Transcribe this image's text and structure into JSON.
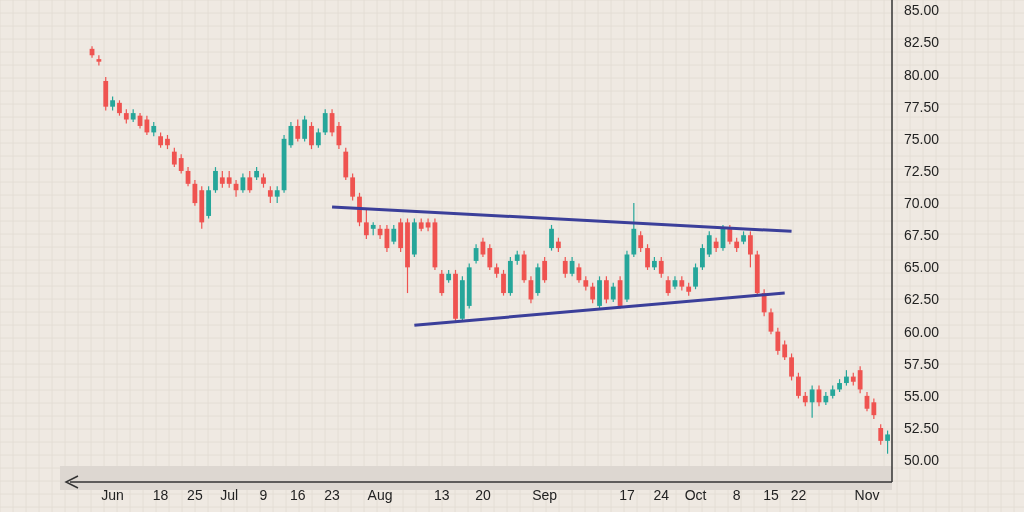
{
  "chart": {
    "chart_data": {
      "type": "candlestick",
      "grid": true,
      "ylim": [
        48.3,
        85.8
      ],
      "categories": [
        null,
        null,
        null,
        "Jun",
        null,
        null,
        null,
        null,
        null,
        null,
        "18",
        null,
        null,
        null,
        null,
        "25",
        null,
        null,
        null,
        null,
        "Jul",
        null,
        null,
        null,
        null,
        "9",
        null,
        null,
        null,
        null,
        "16",
        null,
        null,
        null,
        null,
        "23",
        null,
        null,
        null,
        null,
        null,
        null,
        "Aug",
        null,
        null,
        null,
        null,
        null,
        null,
        null,
        null,
        "13",
        null,
        null,
        null,
        null,
        null,
        "20",
        null,
        null,
        null,
        null,
        null,
        null,
        null,
        null,
        "Sep",
        null,
        null,
        null,
        null,
        null,
        null,
        null,
        null,
        null,
        null,
        null,
        "17",
        null,
        null,
        null,
        null,
        "24",
        null,
        null,
        null,
        null,
        "Oct",
        null,
        null,
        null,
        null,
        null,
        "8",
        null,
        null,
        null,
        null,
        "15",
        null,
        null,
        null,
        "22",
        null,
        null,
        null,
        null,
        null,
        null,
        null,
        null,
        null,
        "Nov",
        null,
        null,
        null
      ],
      "yticks": [
        {
          "value": 50,
          "label": "50.00"
        },
        {
          "value": 52.5,
          "label": "52.50"
        },
        {
          "value": 55,
          "label": "55.00"
        },
        {
          "value": 57.5,
          "label": "57.50"
        },
        {
          "value": 60,
          "label": "60.00"
        },
        {
          "value": 62.5,
          "label": "62.50"
        },
        {
          "value": 65,
          "label": "65.00"
        },
        {
          "value": 67.5,
          "label": "67.50"
        },
        {
          "value": 70,
          "label": "70.00"
        },
        {
          "value": 72.5,
          "label": "72.50"
        },
        {
          "value": 75,
          "label": "75.00"
        },
        {
          "value": 77.5,
          "label": "77.50"
        },
        {
          "value": 80,
          "label": "80.00"
        },
        {
          "value": 82.5,
          "label": "82.50"
        },
        {
          "value": 85,
          "label": "85.00"
        }
      ],
      "ohlc": [
        [
          82,
          82.2,
          81.3,
          81.5
        ],
        [
          81.2,
          81.5,
          80.7,
          81
        ],
        [
          79.5,
          79.8,
          77.2,
          77.5
        ],
        [
          77.5,
          78.3,
          77.2,
          78
        ],
        [
          77.8,
          78,
          76.8,
          77
        ],
        [
          77,
          77.3,
          76.2,
          76.5
        ],
        [
          76.5,
          77.3,
          76.3,
          77
        ],
        [
          76.8,
          77,
          75.8,
          76
        ],
        [
          76.5,
          76.8,
          75.3,
          75.5
        ],
        [
          75.5,
          76.3,
          75.2,
          76
        ],
        [
          75.2,
          75.5,
          74.3,
          74.5
        ],
        [
          75,
          75.3,
          74.2,
          74.5
        ],
        [
          74,
          74.3,
          72.8,
          73
        ],
        [
          73.5,
          73.8,
          72.3,
          72.5
        ],
        [
          72.5,
          72.8,
          71.3,
          71.5
        ],
        [
          71.5,
          71.8,
          69.8,
          70
        ],
        [
          71,
          71.3,
          68,
          68.5
        ],
        [
          69,
          71.3,
          68.8,
          71
        ],
        [
          71,
          72.8,
          70.8,
          72.5
        ],
        [
          72,
          72.5,
          71.2,
          71.5
        ],
        [
          72,
          72.5,
          71.2,
          71.5
        ],
        [
          71.5,
          71.8,
          70.5,
          71
        ],
        [
          71,
          72.3,
          70.8,
          72
        ],
        [
          72,
          72.5,
          70.8,
          71
        ],
        [
          72,
          72.8,
          71.8,
          72.5
        ],
        [
          72,
          72.3,
          71.2,
          71.5
        ],
        [
          71,
          71.3,
          70,
          70.5
        ],
        [
          70.5,
          71.3,
          70,
          71
        ],
        [
          71,
          75.3,
          70.8,
          75
        ],
        [
          74.5,
          76.3,
          74.3,
          76
        ],
        [
          76,
          76.5,
          74.8,
          75
        ],
        [
          75,
          76.8,
          74.8,
          76.5
        ],
        [
          76,
          76.3,
          74.2,
          74.5
        ],
        [
          74.5,
          75.8,
          74.3,
          75.5
        ],
        [
          75.5,
          77.3,
          75.3,
          77
        ],
        [
          77,
          77.3,
          75.2,
          75.5
        ],
        [
          76,
          76.3,
          74.2,
          74.5
        ],
        [
          74,
          74.3,
          71.8,
          72
        ],
        [
          72,
          72.3,
          70.2,
          70.5
        ],
        [
          70.5,
          70.8,
          68.2,
          68.5
        ],
        [
          68.5,
          69.5,
          67.2,
          67.5
        ],
        [
          68,
          68.5,
          67.5,
          68.3
        ],
        [
          68,
          68.3,
          67.2,
          67.5
        ],
        [
          68,
          68.3,
          66.2,
          66.5
        ],
        [
          67,
          68.3,
          66.8,
          68
        ],
        [
          68.5,
          68.8,
          66.2,
          66.5
        ],
        [
          68.5,
          68.8,
          63,
          65
        ],
        [
          66,
          68.8,
          65.8,
          68.5
        ],
        [
          68.5,
          68.8,
          67.8,
          68
        ],
        [
          68.5,
          68.8,
          67.8,
          68.1
        ],
        [
          68.5,
          68.8,
          64.8,
          65
        ],
        [
          64.5,
          64.8,
          62.8,
          63
        ],
        [
          64,
          64.8,
          63.8,
          64.5
        ],
        [
          64.5,
          64.8,
          60.8,
          61
        ],
        [
          61,
          64.3,
          60.8,
          64
        ],
        [
          62,
          65.3,
          61.8,
          65
        ],
        [
          65.5,
          66.8,
          65.3,
          66.5
        ],
        [
          67,
          67.3,
          65.8,
          66
        ],
        [
          66.5,
          66.8,
          64.8,
          65
        ],
        [
          65,
          65.3,
          64.2,
          64.5
        ],
        [
          64.5,
          64.8,
          62.8,
          63
        ],
        [
          63,
          65.8,
          62.8,
          65.5
        ],
        [
          65.5,
          66.3,
          65.2,
          66
        ],
        [
          66,
          66.3,
          63.8,
          64
        ],
        [
          64,
          64.3,
          62.2,
          62.5
        ],
        [
          63,
          65.3,
          62.8,
          65
        ],
        [
          65.5,
          65.8,
          63.8,
          64
        ],
        [
          66.5,
          68.3,
          66.3,
          68
        ],
        [
          67,
          67.3,
          66.2,
          66.5
        ],
        [
          65.5,
          65.8,
          64.2,
          64.5
        ],
        [
          64.5,
          65.8,
          64.3,
          65.5
        ],
        [
          65,
          65.3,
          63.8,
          64
        ],
        [
          64,
          64.3,
          63.2,
          63.5
        ],
        [
          63.5,
          63.8,
          62.2,
          62.5
        ],
        [
          62,
          64.3,
          61.8,
          64
        ],
        [
          64,
          64.3,
          62.2,
          62.5
        ],
        [
          62.5,
          63.8,
          62.3,
          63.5
        ],
        [
          64,
          64.3,
          61.8,
          62
        ],
        [
          62.5,
          66.3,
          62.3,
          66
        ],
        [
          66,
          70,
          65.8,
          68
        ],
        [
          67.5,
          67.8,
          66.2,
          66.5
        ],
        [
          66.5,
          66.8,
          64.8,
          65
        ],
        [
          65,
          65.8,
          64.8,
          65.5
        ],
        [
          65.5,
          65.8,
          64.2,
          64.5
        ],
        [
          64,
          64.3,
          62.8,
          63
        ],
        [
          63.5,
          64.3,
          63.3,
          64
        ],
        [
          64,
          64.3,
          63.2,
          63.5
        ],
        [
          63.5,
          63.8,
          62.8,
          63.1
        ],
        [
          63.5,
          65.3,
          63.3,
          65
        ],
        [
          65,
          66.8,
          64.8,
          66.5
        ],
        [
          66,
          67.8,
          65.8,
          67.5
        ],
        [
          67,
          67.3,
          66.2,
          66.5
        ],
        [
          66.5,
          68.3,
          66.3,
          68
        ],
        [
          68,
          68.3,
          66.8,
          67
        ],
        [
          67,
          67.3,
          66.2,
          66.5
        ],
        [
          67,
          67.8,
          66.8,
          67.5
        ],
        [
          67.5,
          67.8,
          65,
          66
        ],
        [
          66,
          66.3,
          62.8,
          63
        ],
        [
          63,
          63.3,
          61.2,
          61.5
        ],
        [
          61.5,
          61.8,
          59.8,
          60
        ],
        [
          60,
          60.3,
          58.2,
          58.5
        ],
        [
          59,
          59.3,
          57.8,
          58
        ],
        [
          58,
          58.3,
          56.2,
          56.5
        ],
        [
          56.5,
          56.8,
          54.8,
          55
        ],
        [
          55,
          55.3,
          54.2,
          54.5
        ],
        [
          54.5,
          55.8,
          53.3,
          55.5
        ],
        [
          55.5,
          55.8,
          54.2,
          54.5
        ],
        [
          54.5,
          55.3,
          54.3,
          55
        ],
        [
          55,
          55.8,
          54.8,
          55.5
        ],
        [
          55.5,
          56.3,
          55.3,
          56
        ],
        [
          56,
          57,
          55.8,
          56.5
        ],
        [
          56.5,
          56.8,
          55.8,
          56.1
        ],
        [
          57,
          57.3,
          55.2,
          55.5
        ],
        [
          55,
          55.3,
          53.8,
          54
        ],
        [
          54.5,
          54.8,
          53.2,
          53.5
        ],
        [
          52.5,
          52.8,
          51.2,
          51.5
        ],
        [
          51.5,
          52.3,
          50.5,
          52
        ]
      ]
    }
  }
}
